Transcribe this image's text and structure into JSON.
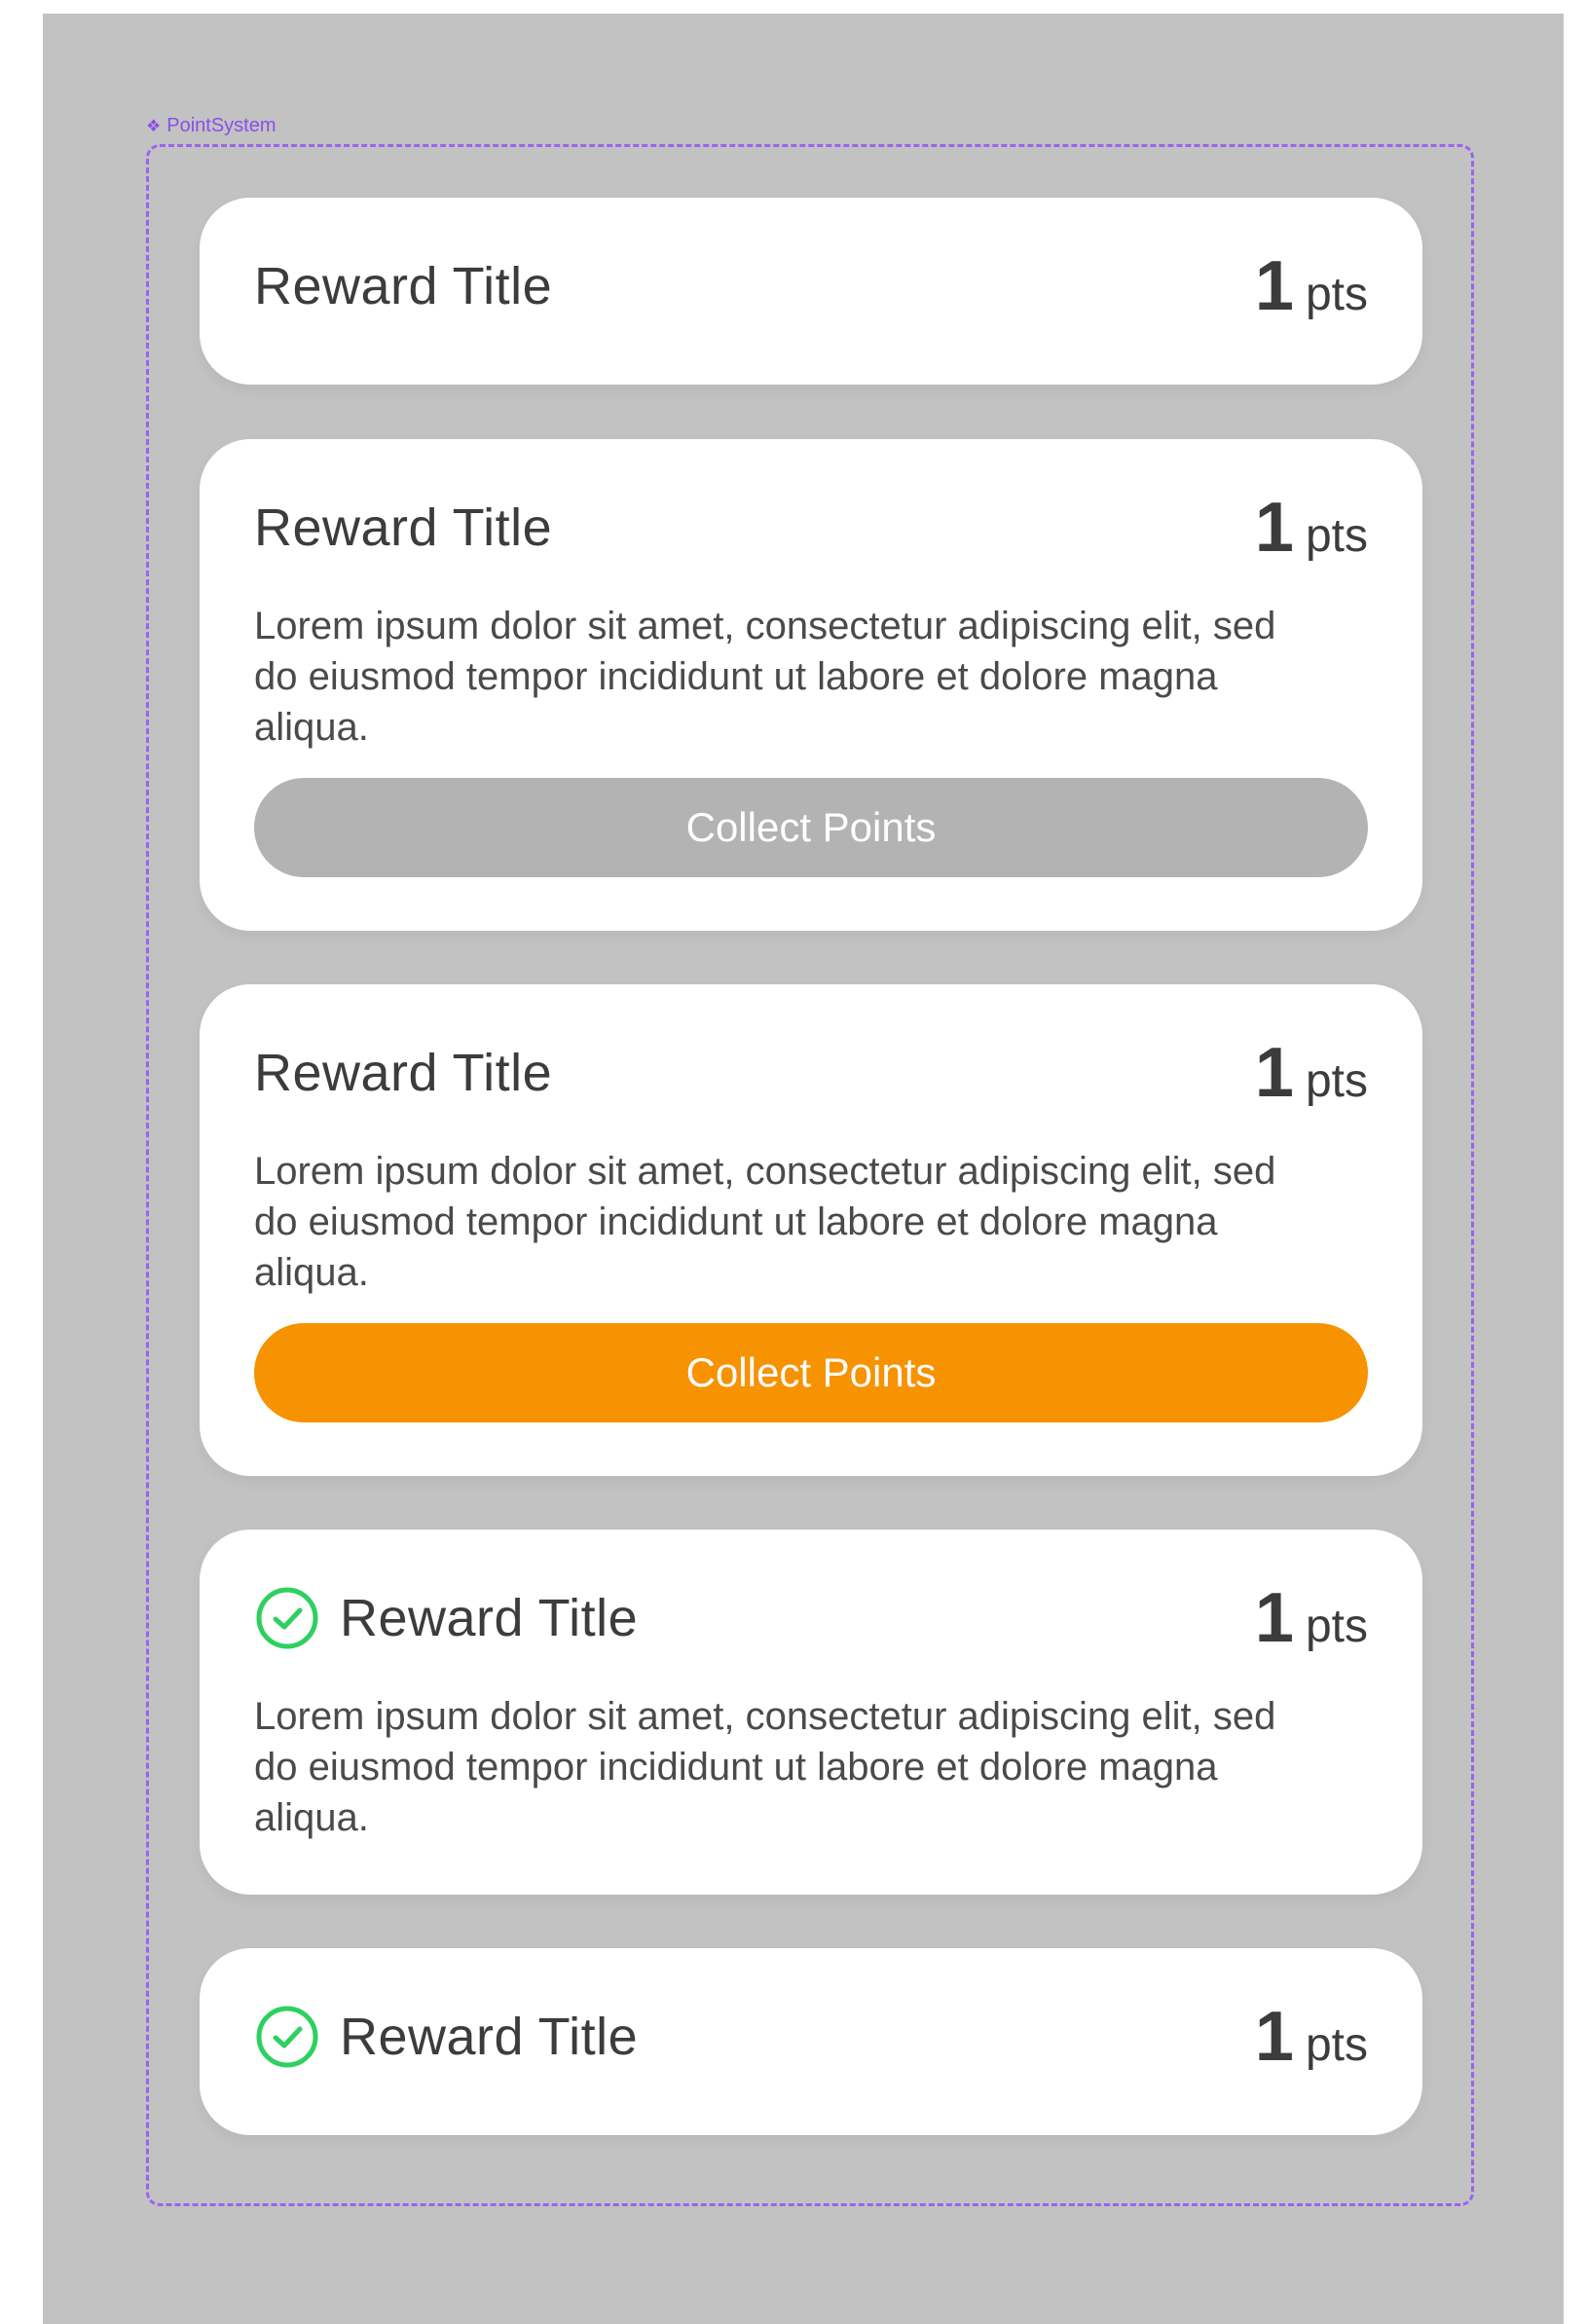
{
  "frame": {
    "label": "PointSystem",
    "label_icon": "component-diamond-icon",
    "accent": "#9b63f0"
  },
  "colors": {
    "background": "#c2c2c2",
    "card": "#ffffff",
    "button_disabled": "#b3b3b3",
    "button_active": "#f79200",
    "check": "#2ed060"
  },
  "cards": [
    {
      "title": "Reward Title",
      "points": "1",
      "unit": "pts",
      "completed": false
    },
    {
      "title": "Reward Title",
      "points": "1",
      "unit": "pts",
      "description": "Lorem ipsum dolor sit amet, consectetur adipiscing elit, sed do eiusmod tempor incididunt ut labore et dolore magna aliqua.",
      "button_label": "Collect Points",
      "button_state": "disabled",
      "completed": false
    },
    {
      "title": "Reward Title",
      "points": "1",
      "unit": "pts",
      "description": "Lorem ipsum dolor sit amet, consectetur adipiscing elit, sed do eiusmod tempor incididunt ut labore et dolore magna aliqua.",
      "button_label": "Collect Points",
      "button_state": "active",
      "completed": false
    },
    {
      "title": "Reward Title",
      "points": "1",
      "unit": "pts",
      "description": "Lorem ipsum dolor sit amet, consectetur adipiscing elit, sed do eiusmod tempor incididunt ut labore et dolore magna aliqua.",
      "completed": true,
      "icon": "check-circle-icon"
    },
    {
      "title": "Reward Title",
      "points": "1",
      "unit": "pts",
      "completed": true,
      "icon": "check-circle-icon"
    }
  ]
}
